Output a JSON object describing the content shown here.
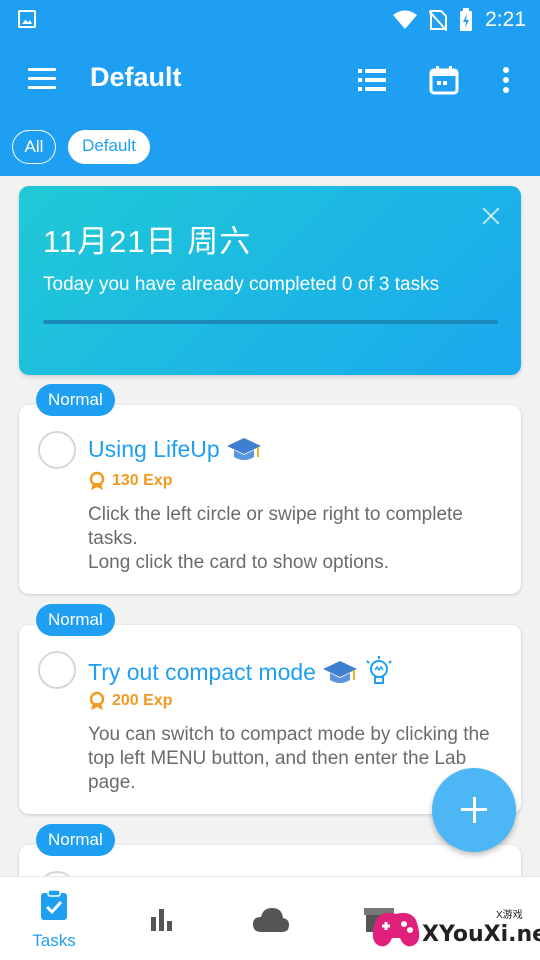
{
  "status_bar": {
    "time": "2:21"
  },
  "app_bar": {
    "title": "Default"
  },
  "chips": [
    {
      "label": "All",
      "selected": false
    },
    {
      "label": "Default",
      "selected": true
    }
  ],
  "summary_card": {
    "date": "11月21日 周六",
    "message": "Today you have already completed 0 of 3 tasks",
    "progress": 0
  },
  "tasks": [
    {
      "badge": "Normal",
      "title": "Using LifeUp",
      "exp": "130 Exp",
      "description_lines": [
        "Click the left circle or swipe right to complete tasks.",
        "Long click the card to show options."
      ]
    },
    {
      "badge": "Normal",
      "title": "Try out compact mode",
      "exp": "200 Exp",
      "description_lines": [
        "You can switch to compact mode by clicking the top left MENU button, and then enter the Lab page."
      ]
    },
    {
      "badge": "Normal",
      "title": "",
      "exp": "",
      "description_lines": []
    }
  ],
  "bottom_nav": {
    "items": [
      {
        "label": "Tasks",
        "icon": "clipboard-check-icon",
        "active": true
      },
      {
        "label": "",
        "icon": "bar-chart-icon",
        "active": false
      },
      {
        "label": "",
        "icon": "cloud-icon",
        "active": false
      },
      {
        "label": "",
        "icon": "shop-icon",
        "active": false
      }
    ]
  },
  "watermark": {
    "text": "XYouXi.net",
    "sub": "X游戏"
  },
  "colors": {
    "primary": "#1e9ff2",
    "exp": "#f19a22",
    "hero_start": "#20c9d6",
    "hero_end": "#1aa8ee"
  }
}
